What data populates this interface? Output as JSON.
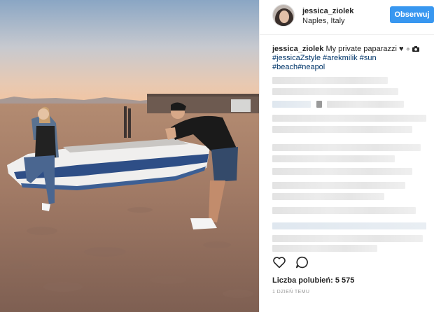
{
  "colors": {
    "accent": "#3897f0",
    "hashtag": "#003569",
    "text": "#262626",
    "muted": "#999999"
  },
  "photo": {
    "description_icon": "photo-icon"
  },
  "header": {
    "username": "jessica_ziolek",
    "location": "Naples, Italy",
    "follow_label": "Obserwuj"
  },
  "caption": {
    "username": "jessica_ziolek",
    "text": " My private paparazzi ",
    "emoji": "♥",
    "hashtags": [
      "#jessicaZstyle",
      "#arekmilik",
      "#sun",
      "#beach",
      "#neapol"
    ]
  },
  "actions": {
    "like_icon": "heart-icon",
    "comment_icon": "comment-icon"
  },
  "likes": {
    "label": "Liczba polubień: 5 575"
  },
  "timestamp": "1 DZIEŃ TEMU"
}
